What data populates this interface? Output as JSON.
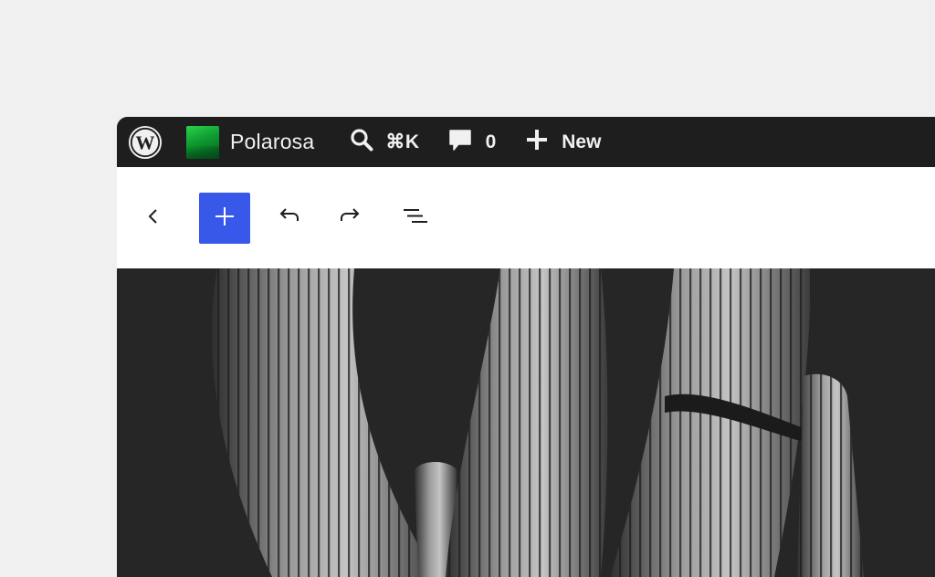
{
  "adminbar": {
    "site_name": "Polarosa",
    "search_shortcut": "⌘K",
    "comments_count": "0",
    "new_label": "New"
  },
  "toolbar": {
    "buttons": [
      "back",
      "add-block",
      "undo",
      "redo",
      "document-overview"
    ]
  },
  "colors": {
    "adminbar_bg": "#1e1e1e",
    "accent": "#3858e9",
    "page_bg": "#f0f0f0"
  },
  "icons": [
    "wordpress-logo-icon",
    "search-icon",
    "comment-icon",
    "plus-icon",
    "chevron-left-icon",
    "undo-icon",
    "redo-icon",
    "list-view-icon"
  ]
}
